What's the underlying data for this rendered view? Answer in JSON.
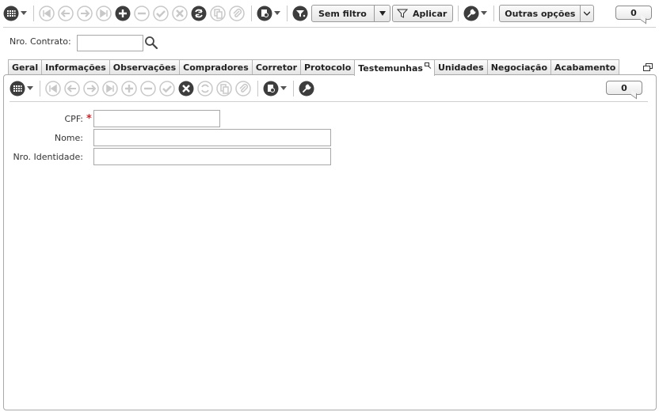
{
  "toolbar_top": {
    "filter_label": "Sem filtro",
    "apply_label": "Aplicar",
    "more_options_label": "Outras opções",
    "record_count": "0"
  },
  "contract": {
    "label": "Nro. Contrato:",
    "value": ""
  },
  "tabs": [
    {
      "label": "Geral"
    },
    {
      "label": "Informações"
    },
    {
      "label": "Observações"
    },
    {
      "label": "Compradores"
    },
    {
      "label": "Corretor"
    },
    {
      "label": "Protocolo"
    },
    {
      "label": "Testemunhas",
      "active": true
    },
    {
      "label": "Unidades"
    },
    {
      "label": "Negociação"
    },
    {
      "label": "Acabamento"
    }
  ],
  "toolbar_inner": {
    "record_count": "0"
  },
  "form": {
    "cpf_label": "CPF:",
    "cpf_required_mark": "*",
    "cpf_value": "",
    "nome_label": "Nome:",
    "nome_value": "",
    "identidade_label": "Nro. Identidade:",
    "identidade_value": ""
  },
  "colors": {
    "required": "#c8282d",
    "icon_dark": "#3c3c3c",
    "icon_disabled": "#c8c8c8"
  }
}
